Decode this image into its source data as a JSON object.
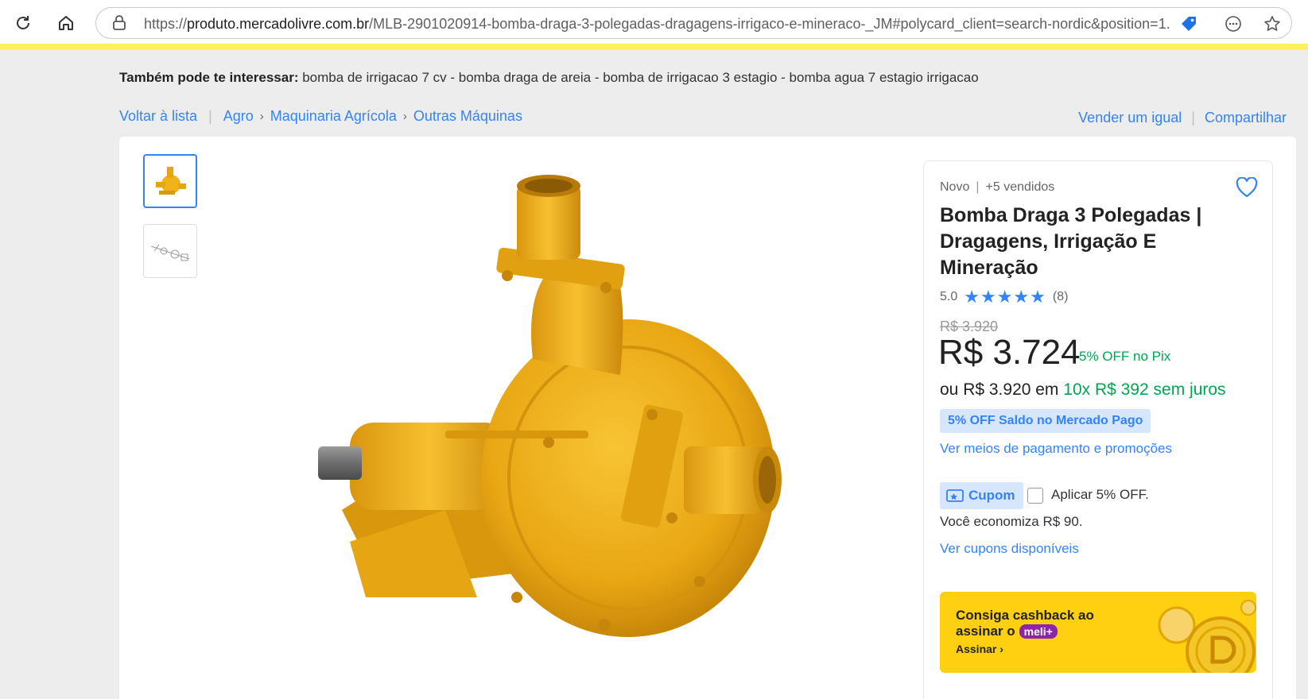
{
  "browser": {
    "url_prefix": "https://",
    "url_host": "produto.mercadolivre.com.br",
    "url_path": "/MLB-2901020914-bomba-draga-3-polegadas-dragagens-irrigaco-e-mineraco-_JM#polycard_client=search-nordic&position=1..."
  },
  "related": {
    "label": "Também pode te interessar:",
    "items": "bomba de irrigacao 7 cv - bomba draga de areia - bomba de irrigacao 3 estagio - bomba agua 7 estagio irrigacao"
  },
  "breadcrumb": {
    "back": "Voltar à lista",
    "items": [
      "Agro",
      "Maquinaria Agrícola",
      "Outras Máquinas"
    ]
  },
  "actions": {
    "sell": "Vender um igual",
    "share": "Compartilhar"
  },
  "product": {
    "condition": "Novo",
    "sold": "+5 vendidos",
    "title": "Bomba Draga 3 Polegadas | Dragagens, Irrigação E Mineração",
    "rating": "5.0",
    "reviews": "(8)",
    "stars": "★★★★★",
    "old_price": "R$ 3.920",
    "price": "R$ 3.724",
    "pix_discount": "5% OFF no Pix",
    "install_prefix": "ou R$ 3.920 em",
    "install_green": "10x R$ 392 sem juros",
    "mp_badge": "5% OFF Saldo no Mercado Pago",
    "payment_link": "Ver meios de pagamento e promoções",
    "coupon_label": "Cupom",
    "coupon_apply": "Aplicar 5% OFF.",
    "savings": "Você economiza R$ 90.",
    "coupons_link": "Ver cupons disponíveis"
  },
  "banner": {
    "line1": "Consiga cashback ao",
    "line2": "assinar o",
    "brand": "meli+",
    "cta": "Assinar ›"
  },
  "colors": {
    "accent": "#3483fa",
    "green": "#00a650",
    "brand_yellow": "#fff159",
    "product_yellow": "#f2b21c"
  }
}
